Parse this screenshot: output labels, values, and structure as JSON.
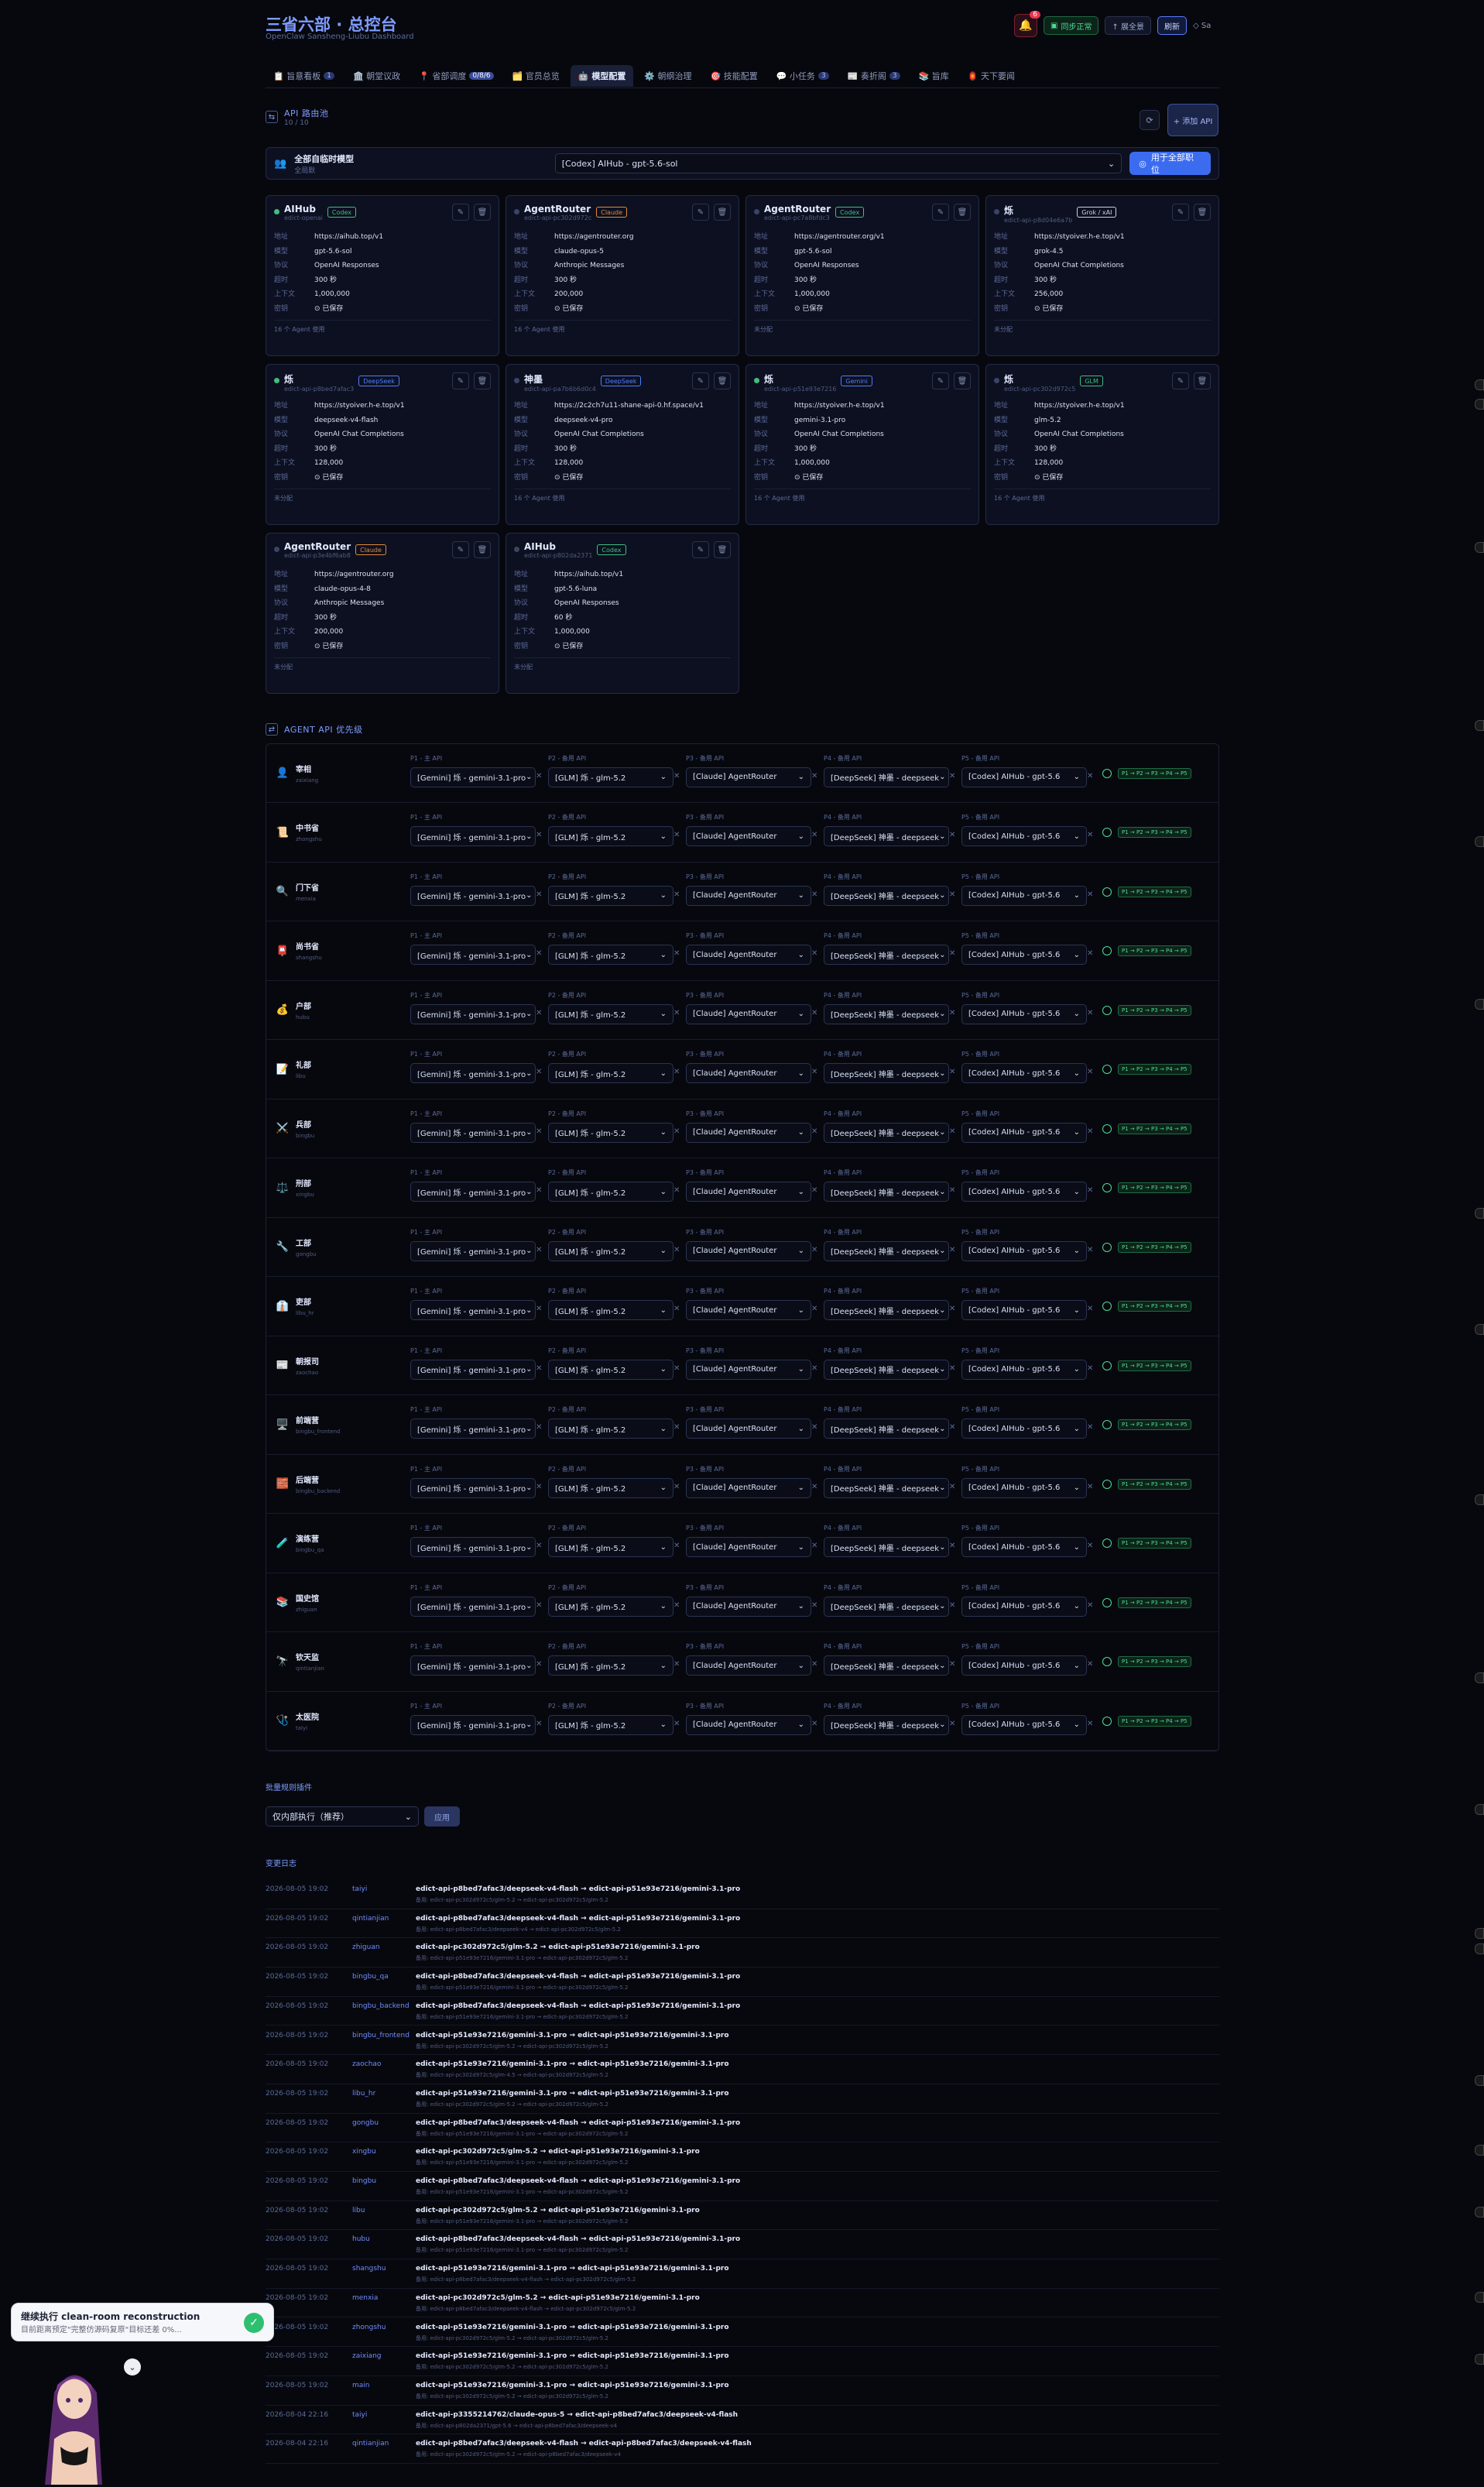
{
  "header": {
    "title": "三省六部 · 总控台",
    "subtitle": "OpenClaw Sansheng-Liubu Dashboard",
    "bell_count": "6",
    "sync_label": "同步正常",
    "expand_label": "↑ 展全景",
    "refresh_label": "刷新",
    "extra_label": "◇ Sa"
  },
  "tabs": [
    {
      "label": "📋 旨意看板",
      "count": "1"
    },
    {
      "label": "🏛️ 朝堂议政",
      "count": ""
    },
    {
      "label": "📍 省部调度",
      "count": "0/8/6"
    },
    {
      "label": "🗂️ 官员总览",
      "count": ""
    },
    {
      "label": "🤖 模型配置",
      "count": ""
    },
    {
      "label": "⚙️ 朝纲治理",
      "count": ""
    },
    {
      "label": "🎯 技能配置",
      "count": ""
    },
    {
      "label": "💬 小任务",
      "count": "3"
    },
    {
      "label": "📰 奏折阁",
      "count": "3"
    },
    {
      "label": "📚 旨库",
      "count": ""
    },
    {
      "label": "🏮 天下要闻",
      "count": ""
    }
  ],
  "api_section": {
    "title": "API 路由池",
    "sub": "10 / 10",
    "add_label": "+ 添加 API"
  },
  "global": {
    "label": "全部自临时模型",
    "sub": "全局默",
    "selected": "[Codex] AIHub - gpt-5.6-sol",
    "apply_label": "用于全部职位"
  },
  "field_labels": [
    "地址",
    "模型",
    "协议",
    "超时",
    "上下文",
    "密钥"
  ],
  "key_saved": "已保存",
  "cards": [
    {
      "name": "AIHub",
      "id": "edict-openai",
      "tag": "Codex",
      "tag_color": "#3fbf7f",
      "dot": "#3fbf7f",
      "url": "https://aihub.top/v1",
      "model": "gpt-5.6-sol",
      "protocol": "OpenAI Responses",
      "timeout": "300 秒",
      "context": "1,000,000",
      "footer": "16 个 Agent 使用"
    },
    {
      "name": "AgentRouter",
      "id": "edict-api-pc302d972c",
      "tag": "Claude",
      "tag_color": "#e08a3c",
      "dot": "#3a4466",
      "url": "https://agentrouter.org",
      "model": "claude-opus-5",
      "protocol": "Anthropic Messages",
      "timeout": "300 秒",
      "context": "200,000",
      "footer": "16 个 Agent 使用"
    },
    {
      "name": "AgentRouter",
      "id": "edict-api-pc7a8bfdc3",
      "tag": "Codex",
      "tag_color": "#3fbf7f",
      "dot": "#3a4466",
      "url": "https://agentrouter.org/v1",
      "model": "gpt-5.6-sol",
      "protocol": "OpenAI Responses",
      "timeout": "300 秒",
      "context": "1,000,000",
      "footer": "未分配"
    },
    {
      "name": "烁",
      "id": "edict-api-p8d04e6a7b",
      "tag": "Grok / xAI",
      "tag_color": "#c9d1e4",
      "dot": "#3a4466",
      "url": "https://styoiver.h-e.top/v1",
      "model": "grok-4.5",
      "protocol": "OpenAI Chat Completions",
      "timeout": "300 秒",
      "context": "256,000",
      "footer": "未分配"
    },
    {
      "name": "烁",
      "id": "edict-api-p8bed7afac3",
      "tag": "DeepSeek",
      "tag_color": "#4d7dff",
      "dot": "#3fbf7f",
      "url": "https://styoiver.h-e.top/v1",
      "model": "deepseek-v4-flash",
      "protocol": "OpenAI Chat Completions",
      "timeout": "300 秒",
      "context": "128,000",
      "footer": "未分配"
    },
    {
      "name": "神墨",
      "id": "edict-api-pa7b6b6d0c4",
      "tag": "DeepSeek",
      "tag_color": "#4d7dff",
      "dot": "#3a4466",
      "url": "https://2c2ch7u11-shane-api-0.hf.space/v1",
      "model": "deepseek-v4-pro",
      "protocol": "OpenAI Chat Completions",
      "timeout": "300 秒",
      "context": "128,000",
      "footer": "16 个 Agent 使用"
    },
    {
      "name": "烁",
      "id": "edict-api-p51e93e7216",
      "tag": "Gemini",
      "tag_color": "#4d7dff",
      "dot": "#3fbf7f",
      "url": "https://styoiver.h-e.top/v1",
      "model": "gemini-3.1-pro",
      "protocol": "OpenAI Chat Completions",
      "timeout": "300 秒",
      "context": "1,000,000",
      "footer": "16 个 Agent 使用"
    },
    {
      "name": "烁",
      "id": "edict-api-pc302d972c5",
      "tag": "GLM",
      "tag_color": "#3fbf7f",
      "dot": "#3a4466",
      "url": "https://styoiver.h-e.top/v1",
      "model": "glm-5.2",
      "protocol": "OpenAI Chat Completions",
      "timeout": "300 秒",
      "context": "128,000",
      "footer": "16 个 Agent 使用"
    },
    {
      "name": "AgentRouter",
      "id": "edict-api-p3e4bf6ab8",
      "tag": "Claude",
      "tag_color": "#e08a3c",
      "dot": "#3a4466",
      "url": "https://agentrouter.org",
      "model": "claude-opus-4-8",
      "protocol": "Anthropic Messages",
      "timeout": "300 秒",
      "context": "200,000",
      "footer": "未分配"
    },
    {
      "name": "AIHub",
      "id": "edict-api-p802da2371",
      "tag": "Codex",
      "tag_color": "#3fbf7f",
      "dot": "#3a4466",
      "url": "https://aihub.top/v1",
      "model": "gpt-5.6-luna",
      "protocol": "OpenAI Responses",
      "timeout": "60 秒",
      "context": "1,000,000",
      "footer": "未分配"
    }
  ],
  "priority": {
    "title": "AGENT API 优先级",
    "slot_labels": [
      "P1 - 主 API",
      "P2 - 备用 API",
      "P3 - 备用 API",
      "P4 - 备用 API",
      "P5 - 备用 API"
    ],
    "slot_values": [
      "[Gemini] 烁 - gemini-3.1-pro",
      "[GLM] 烁 - glm-5.2",
      "[Claude] AgentRouter",
      "[DeepSeek] 神墨 - deepseek",
      "[Codex] AIHub - gpt-5.6"
    ],
    "chain": "P1 → P2 → P3 → P4 → P5",
    "agents": [
      {
        "icon": "👤",
        "name": "宰相",
        "id": "zaixiang"
      },
      {
        "icon": "📜",
        "name": "中书省",
        "id": "zhongshu"
      },
      {
        "icon": "🔍",
        "name": "门下省",
        "id": "menxia"
      },
      {
        "icon": "📮",
        "name": "尚书省",
        "id": "shangshu"
      },
      {
        "icon": "💰",
        "name": "户部",
        "id": "hubu"
      },
      {
        "icon": "📝",
        "name": "礼部",
        "id": "libu"
      },
      {
        "icon": "⚔️",
        "name": "兵部",
        "id": "bingbu"
      },
      {
        "icon": "⚖️",
        "name": "刑部",
        "id": "xingbu"
      },
      {
        "icon": "🔧",
        "name": "工部",
        "id": "gongbu"
      },
      {
        "icon": "👔",
        "name": "吏部",
        "id": "libu_hr"
      },
      {
        "icon": "📰",
        "name": "朝报司",
        "id": "zaochao"
      },
      {
        "icon": "🖥️",
        "name": "前端营",
        "id": "bingbu_frontend"
      },
      {
        "icon": "🧱",
        "name": "后端营",
        "id": "bingbu_backend"
      },
      {
        "icon": "🧪",
        "name": "演练营",
        "id": "bingbu_qa"
      },
      {
        "icon": "📚",
        "name": "国史馆",
        "id": "zhiguan"
      },
      {
        "icon": "🔭",
        "name": "钦天监",
        "id": "qintianjian"
      },
      {
        "icon": "🩺",
        "name": "太医院",
        "id": "taiyi"
      }
    ]
  },
  "bulk": {
    "title": "批量规则插件",
    "selected": "仅内部执行（推荐）",
    "apply_label": "应用"
  },
  "log": {
    "title": "变更日志",
    "rows": [
      {
        "time": "2026-08-05 19:02",
        "agent": "taiyi",
        "main": "edict-api-p8bed7afac3/deepseek-v4-flash → edict-api-p51e93e7216/gemini-3.1-pro",
        "sub": "备用: edict-api-pc302d972c5/glm-5.2 → edict-api-pc302d972c5/glm-5.2"
      },
      {
        "time": "2026-08-05 19:02",
        "agent": "qintianjian",
        "main": "edict-api-p8bed7afac3/deepseek-v4-flash → edict-api-p51e93e7216/gemini-3.1-pro",
        "sub": "备用: edict-api-p8bed7afac3/deepseek-v4 → edict-api-pc302d972c5/glm-5.2"
      },
      {
        "time": "2026-08-05 19:02",
        "agent": "zhiguan",
        "main": "edict-api-pc302d972c5/glm-5.2 → edict-api-p51e93e7216/gemini-3.1-pro",
        "sub": "备用: edict-api-p51e93e7216/gemini-3.1-pro → edict-api-pc302d972c5/glm-5.2"
      },
      {
        "time": "2026-08-05 19:02",
        "agent": "bingbu_qa",
        "main": "edict-api-p8bed7afac3/deepseek-v4-flash → edict-api-p51e93e7216/gemini-3.1-pro",
        "sub": "备用: edict-api-p51e93e7216/gemini-3.1-pro → edict-api-pc302d972c5/glm-5.2"
      },
      {
        "time": "2026-08-05 19:02",
        "agent": "bingbu_backend",
        "main": "edict-api-p8bed7afac3/deepseek-v4-flash → edict-api-p51e93e7216/gemini-3.1-pro",
        "sub": "备用: edict-api-p51e93e7216/gemini-3.1-pro → edict-api-pc302d972c5/glm-5.2"
      },
      {
        "time": "2026-08-05 19:02",
        "agent": "bingbu_frontend",
        "main": "edict-api-p51e93e7216/gemini-3.1-pro → edict-api-p51e93e7216/gemini-3.1-pro",
        "sub": "备用: edict-api-pc302d972c5/glm-5.2 → edict-api-pc302d972c5/glm-5.2"
      },
      {
        "time": "2026-08-05 19:02",
        "agent": "zaochao",
        "main": "edict-api-p51e93e7216/gemini-3.1-pro → edict-api-p51e93e7216/gemini-3.1-pro",
        "sub": "备用: edict-api-pc302d972c5/glm-4.5 → edict-api-pc302d972c5/glm-5.2"
      },
      {
        "time": "2026-08-05 19:02",
        "agent": "libu_hr",
        "main": "edict-api-p51e93e7216/gemini-3.1-pro → edict-api-p51e93e7216/gemini-3.1-pro",
        "sub": "备用: edict-api-pc302d972c5/glm-5.2 → edict-api-pc302d972c5/glm-5.2"
      },
      {
        "time": "2026-08-05 19:02",
        "agent": "gongbu",
        "main": "edict-api-p8bed7afac3/deepseek-v4-flash → edict-api-p51e93e7216/gemini-3.1-pro",
        "sub": "备用: edict-api-p51e93e7216/gemini-3.1-pro → edict-api-pc302d972c5/glm-5.2"
      },
      {
        "time": "2026-08-05 19:02",
        "agent": "xingbu",
        "main": "edict-api-pc302d972c5/glm-5.2 → edict-api-p51e93e7216/gemini-3.1-pro",
        "sub": "备用: edict-api-p51e93e7216/gemini-3.1-pro → edict-api-pc302d972c5/glm-5.2"
      },
      {
        "time": "2026-08-05 19:02",
        "agent": "bingbu",
        "main": "edict-api-p8bed7afac3/deepseek-v4-flash → edict-api-p51e93e7216/gemini-3.1-pro",
        "sub": "备用: edict-api-p51e93e7216/gemini-3.1-pro → edict-api-pc302d972c5/glm-5.2"
      },
      {
        "time": "2026-08-05 19:02",
        "agent": "libu",
        "main": "edict-api-pc302d972c5/glm-5.2 → edict-api-p51e93e7216/gemini-3.1-pro",
        "sub": "备用: edict-api-p51e93e7216/gemini-3.1-pro → edict-api-pc302d972c5/glm-5.2"
      },
      {
        "time": "2026-08-05 19:02",
        "agent": "hubu",
        "main": "edict-api-p8bed7afac3/deepseek-v4-flash → edict-api-p51e93e7216/gemini-3.1-pro",
        "sub": "备用: edict-api-p51e93e7216/gemini-3.1-pro → edict-api-pc302d972c5/glm-5.2"
      },
      {
        "time": "2026-08-05 19:02",
        "agent": "shangshu",
        "main": "edict-api-p51e93e7216/gemini-3.1-pro → edict-api-p51e93e7216/gemini-3.1-pro",
        "sub": "备用: edict-api-p8bed7afac3/deepseek-v4-flash → edict-api-pc302d972c5/glm-5.2"
      },
      {
        "time": "2026-08-05 19:02",
        "agent": "menxia",
        "main": "edict-api-pc302d972c5/glm-5.2 → edict-api-p51e93e7216/gemini-3.1-pro",
        "sub": "备用: edict-api-p8bed7afac3/deepseek-v4-flash → edict-api-pc302d972c5/glm-5.2"
      },
      {
        "time": "2026-08-05 19:02",
        "agent": "zhongshu",
        "main": "edict-api-p51e93e7216/gemini-3.1-pro → edict-api-p51e93e7216/gemini-3.1-pro",
        "sub": "备用: edict-api-pc302d972c5/glm-5.2 → edict-api-pc302d972c5/glm-5.2"
      },
      {
        "time": "2026-08-05 19:02",
        "agent": "zaixiang",
        "main": "edict-api-p51e93e7216/gemini-3.1-pro → edict-api-p51e93e7216/gemini-3.1-pro",
        "sub": "备用: edict-api-pc302d972c5/glm-5.2 → edict-api-pc302d972c5/glm-5.2"
      },
      {
        "time": "2026-08-05 19:02",
        "agent": "main",
        "main": "edict-api-p51e93e7216/gemini-3.1-pro → edict-api-p51e93e7216/gemini-3.1-pro",
        "sub": "备用: edict-api-pc302d972c5/glm-5.2 → edict-api-pc302d972c5/glm-5.2"
      },
      {
        "time": "2026-08-04 22:16",
        "agent": "taiyi",
        "main": "edict-api-p3355214762/claude-opus-5 → edict-api-p8bed7afac3/deepseek-v4-flash",
        "sub": "备用: edict-api-p802da2371/gpt-5.6 → edict-api-p8bed7afac3/deepseek-v4"
      },
      {
        "time": "2026-08-04 22:16",
        "agent": "qintianjian",
        "main": "edict-api-p8bed7afac3/deepseek-v4-flash → edict-api-p8bed7afac3/deepseek-v4-flash",
        "sub": "备用: edict-api-pc302d972c5/glm-5.2 → edict-api-p8bed7afac3/deepseek-v4"
      }
    ]
  },
  "toast": {
    "title": "继续执行 clean-room reconstruction",
    "text": "目前距离预定\"完整仿源码复原\"目标还差 0%..."
  }
}
